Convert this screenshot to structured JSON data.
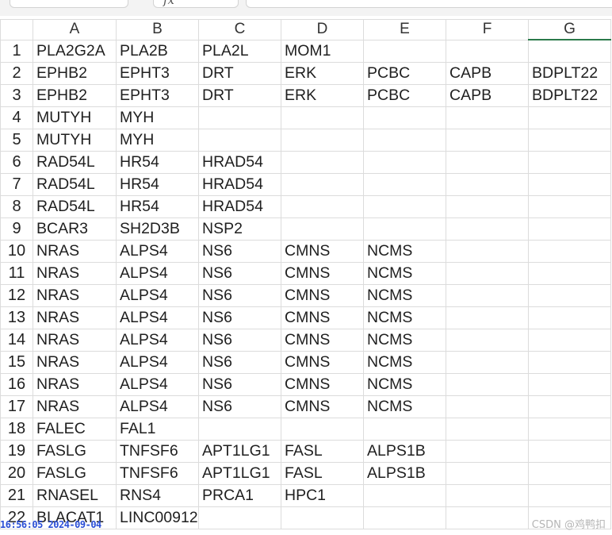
{
  "toolbar": {
    "formula_text": "fx"
  },
  "columns": [
    "A",
    "B",
    "C",
    "D",
    "E",
    "F",
    "G"
  ],
  "rows": [
    {
      "num": "1",
      "cells": [
        "PLA2G2A",
        "PLA2B",
        "PLA2L",
        "MOM1",
        "",
        "",
        ""
      ]
    },
    {
      "num": "2",
      "cells": [
        "EPHB2",
        "EPHT3",
        "DRT",
        "ERK",
        "PCBC",
        "CAPB",
        "BDPLT22"
      ]
    },
    {
      "num": "3",
      "cells": [
        "EPHB2",
        "EPHT3",
        "DRT",
        "ERK",
        "PCBC",
        "CAPB",
        "BDPLT22"
      ]
    },
    {
      "num": "4",
      "cells": [
        "MUTYH",
        "MYH",
        "",
        "",
        "",
        "",
        ""
      ]
    },
    {
      "num": "5",
      "cells": [
        "MUTYH",
        "MYH",
        "",
        "",
        "",
        "",
        ""
      ]
    },
    {
      "num": "6",
      "cells": [
        "RAD54L",
        "HR54",
        "HRAD54",
        "",
        "",
        "",
        ""
      ]
    },
    {
      "num": "7",
      "cells": [
        "RAD54L",
        "HR54",
        "HRAD54",
        "",
        "",
        "",
        ""
      ]
    },
    {
      "num": "8",
      "cells": [
        "RAD54L",
        "HR54",
        "HRAD54",
        "",
        "",
        "",
        ""
      ]
    },
    {
      "num": "9",
      "cells": [
        "BCAR3",
        "SH2D3B",
        "NSP2",
        "",
        "",
        "",
        ""
      ]
    },
    {
      "num": "10",
      "cells": [
        "NRAS",
        "ALPS4",
        "NS6",
        "CMNS",
        "NCMS",
        "",
        ""
      ]
    },
    {
      "num": "11",
      "cells": [
        "NRAS",
        "ALPS4",
        "NS6",
        "CMNS",
        "NCMS",
        "",
        ""
      ]
    },
    {
      "num": "12",
      "cells": [
        "NRAS",
        "ALPS4",
        "NS6",
        "CMNS",
        "NCMS",
        "",
        ""
      ]
    },
    {
      "num": "13",
      "cells": [
        "NRAS",
        "ALPS4",
        "NS6",
        "CMNS",
        "NCMS",
        "",
        ""
      ]
    },
    {
      "num": "14",
      "cells": [
        "NRAS",
        "ALPS4",
        "NS6",
        "CMNS",
        "NCMS",
        "",
        ""
      ]
    },
    {
      "num": "15",
      "cells": [
        "NRAS",
        "ALPS4",
        "NS6",
        "CMNS",
        "NCMS",
        "",
        ""
      ]
    },
    {
      "num": "16",
      "cells": [
        "NRAS",
        "ALPS4",
        "NS6",
        "CMNS",
        "NCMS",
        "",
        ""
      ]
    },
    {
      "num": "17",
      "cells": [
        "NRAS",
        "ALPS4",
        "NS6",
        "CMNS",
        "NCMS",
        "",
        ""
      ]
    },
    {
      "num": "18",
      "cells": [
        "FALEC",
        "FAL1",
        "",
        "",
        "",
        "",
        ""
      ]
    },
    {
      "num": "19",
      "cells": [
        "FASLG",
        "TNFSF6",
        "APT1LG1",
        "FASL",
        "ALPS1B",
        "",
        ""
      ]
    },
    {
      "num": "20",
      "cells": [
        "FASLG",
        "TNFSF6",
        "APT1LG1",
        "FASL",
        "ALPS1B",
        "",
        ""
      ]
    },
    {
      "num": "21",
      "cells": [
        "RNASEL",
        "RNS4",
        "PRCA1",
        "HPC1",
        "",
        "",
        ""
      ]
    },
    {
      "num": "22",
      "cells": [
        "BLACAT1",
        "LINC00912",
        "",
        "",
        "",
        "",
        ""
      ]
    }
  ],
  "timestamp": "16:56:05 2024-09-04",
  "watermark": "CSDN @鸡鸭扣"
}
